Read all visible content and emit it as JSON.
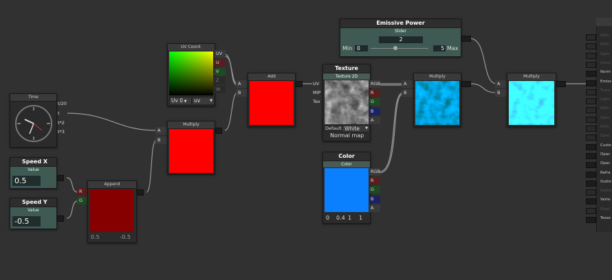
{
  "nodes": {
    "time": {
      "title": "Time",
      "outputs": [
        "t/20",
        "t",
        "t*2",
        "t*3"
      ]
    },
    "speed_x": {
      "title": "Speed X",
      "sub": "Value",
      "value": "0.5"
    },
    "speed_y": {
      "title": "Speed Y",
      "sub": "Value",
      "value": "-0.5"
    },
    "append": {
      "title": "Append",
      "inputs": [
        "R",
        "G"
      ],
      "footer_left": "0.5",
      "footer_right": "-0.5"
    },
    "uv": {
      "title": "UV Coord.",
      "outputs": [
        "UV",
        "U",
        "V",
        "Z",
        "W"
      ],
      "dropdown1": "Uv 0",
      "dropdown2": "uv"
    },
    "multiply1": {
      "title": "Multiply",
      "inputs": [
        "A",
        "B"
      ]
    },
    "add": {
      "title": "Add",
      "inputs": [
        "A",
        "B"
      ]
    },
    "texture": {
      "title": "Texture",
      "sub": "Texture 2D",
      "inputs": [
        "UV",
        "MIP",
        "Tex"
      ],
      "outputs": [
        "RGB",
        "R",
        "G",
        "B",
        "A"
      ],
      "default_label": "Default",
      "default_value": "White",
      "normal": "Normal map"
    },
    "color": {
      "title": "Color",
      "sub": "Color",
      "outputs": [
        "RGB",
        "R",
        "G",
        "B",
        "A"
      ],
      "vals": [
        "0",
        "0.4",
        "1",
        "1"
      ]
    },
    "emissive": {
      "title": "Emissive Power",
      "sub": "Slider",
      "value": "2",
      "min_label": "Min",
      "min": "0",
      "max": "5",
      "max_label": "Max"
    },
    "multiply2": {
      "title": "Multiply",
      "inputs": [
        "A",
        "B"
      ]
    },
    "multiply3": {
      "title": "Multiply",
      "inputs": [
        "A",
        "B"
      ]
    }
  },
  "side_panel": [
    {
      "label": "Diffu",
      "active": false
    },
    {
      "label": "Diffu",
      "active": false
    },
    {
      "label": "Spec",
      "active": false
    },
    {
      "label": "Gloss",
      "active": false
    },
    {
      "label": "Norm",
      "active": true
    },
    {
      "label": "Emiss",
      "active": true
    },
    {
      "label": "Trans",
      "active": false
    },
    {
      "label": "Light",
      "active": false
    },
    {
      "label": "Diffu",
      "active": false
    },
    {
      "label": "Spec",
      "active": false
    },
    {
      "label": "Diffu",
      "active": false
    },
    {
      "label": "Spec",
      "active": false
    },
    {
      "label": "Custo",
      "active": true
    },
    {
      "label": "Opac",
      "active": true
    },
    {
      "label": "Opac",
      "active": true
    },
    {
      "label": "Refra",
      "active": true
    },
    {
      "label": "Outlin",
      "active": true
    },
    {
      "label": "Outlin",
      "active": false
    },
    {
      "label": "Verte",
      "active": true
    },
    {
      "label": "Displ",
      "active": false
    },
    {
      "label": "Tesse",
      "active": true
    }
  ]
}
